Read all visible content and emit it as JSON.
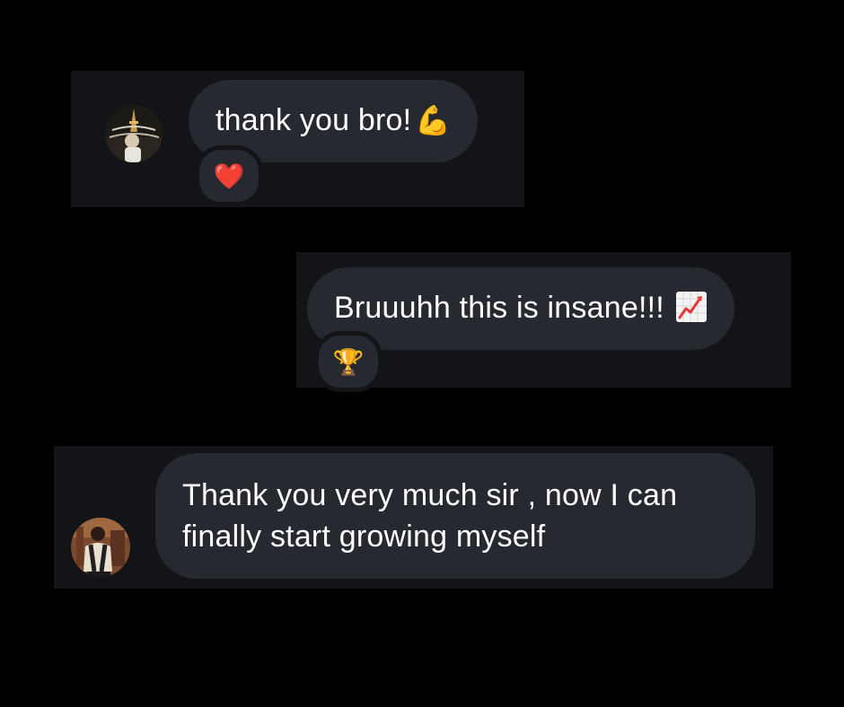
{
  "messages": [
    {
      "id": "msg1",
      "sender": "other",
      "text": "thank you bro!",
      "emoji": "💪",
      "reaction": "❤️",
      "avatar_icon": "profile-photo-eiffel-tower"
    },
    {
      "id": "msg2",
      "sender": "me",
      "text": "Bruuuhh this is insane!!!",
      "emoji_icon": "chart-increasing-icon",
      "reaction": "🏆"
    },
    {
      "id": "msg3",
      "sender": "other",
      "text": "Thank you very much sir , now I can finally start growing myself",
      "avatar_icon": "profile-photo-person"
    }
  ],
  "colors": {
    "background": "#000000",
    "card": "#121418",
    "bubble": "#26292f",
    "text": "#ffffff",
    "chart_icon_line": "#e53935",
    "heart": "#e0143c",
    "trophy": "#d4a017"
  }
}
